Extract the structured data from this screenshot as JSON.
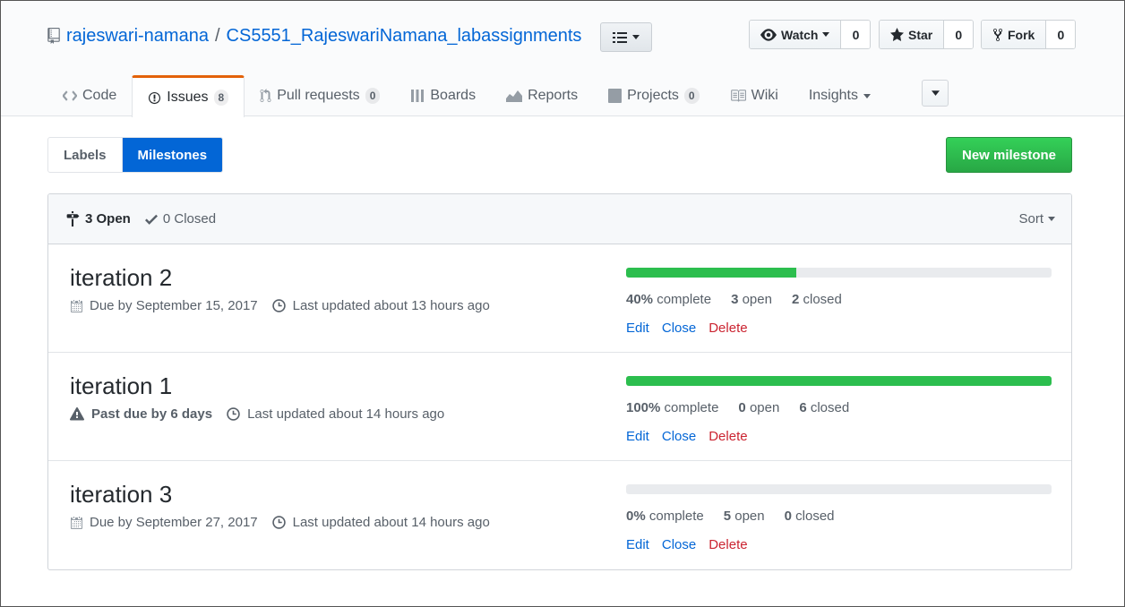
{
  "repo": {
    "owner": "rajeswari-namana",
    "slash": "/",
    "name": "CS5551_RajeswariNamana_labassignments"
  },
  "actions": {
    "watch": {
      "label": "Watch",
      "count": "0"
    },
    "star": {
      "label": "Star",
      "count": "0"
    },
    "fork": {
      "label": "Fork",
      "count": "0"
    }
  },
  "tabs": [
    {
      "label": "Code"
    },
    {
      "label": "Issues",
      "count": "8"
    },
    {
      "label": "Pull requests",
      "count": "0"
    },
    {
      "label": "Boards"
    },
    {
      "label": "Reports"
    },
    {
      "label": "Projects",
      "count": "0"
    },
    {
      "label": "Wiki"
    },
    {
      "label": "Insights"
    }
  ],
  "subnav": {
    "labels": "Labels",
    "milestones": "Milestones"
  },
  "new_milestone": "New milestone",
  "table_head": {
    "open": "3 Open",
    "closed": "0 Closed",
    "sort": "Sort"
  },
  "milestones": [
    {
      "title": "iteration 2",
      "due": "Due by September 15, 2017",
      "updated": "Last updated about 13 hours ago",
      "percent": 40,
      "percent_label": "40%",
      "complete_word": "complete",
      "open_count": "3",
      "open_word": "open",
      "closed_count": "2",
      "closed_word": "closed"
    },
    {
      "title": "iteration 1",
      "due": "Past due by 6 days",
      "updated": "Last updated about 14 hours ago",
      "percent": 100,
      "percent_label": "100%",
      "complete_word": "complete",
      "open_count": "0",
      "open_word": "open",
      "closed_count": "6",
      "closed_word": "closed"
    },
    {
      "title": "iteration 3",
      "due": "Due by September 27, 2017",
      "updated": "Last updated about 14 hours ago",
      "percent": 0,
      "percent_label": "0%",
      "complete_word": "complete",
      "open_count": "5",
      "open_word": "open",
      "closed_count": "0",
      "closed_word": "closed"
    }
  ],
  "row_actions": {
    "edit": "Edit",
    "close": "Close",
    "delete": "Delete"
  },
  "colors": {
    "link": "#0366d6",
    "progress": "#2cbe4e",
    "danger": "#cb2431",
    "tab_accent": "#e36209",
    "primary_button": "#28a745"
  }
}
